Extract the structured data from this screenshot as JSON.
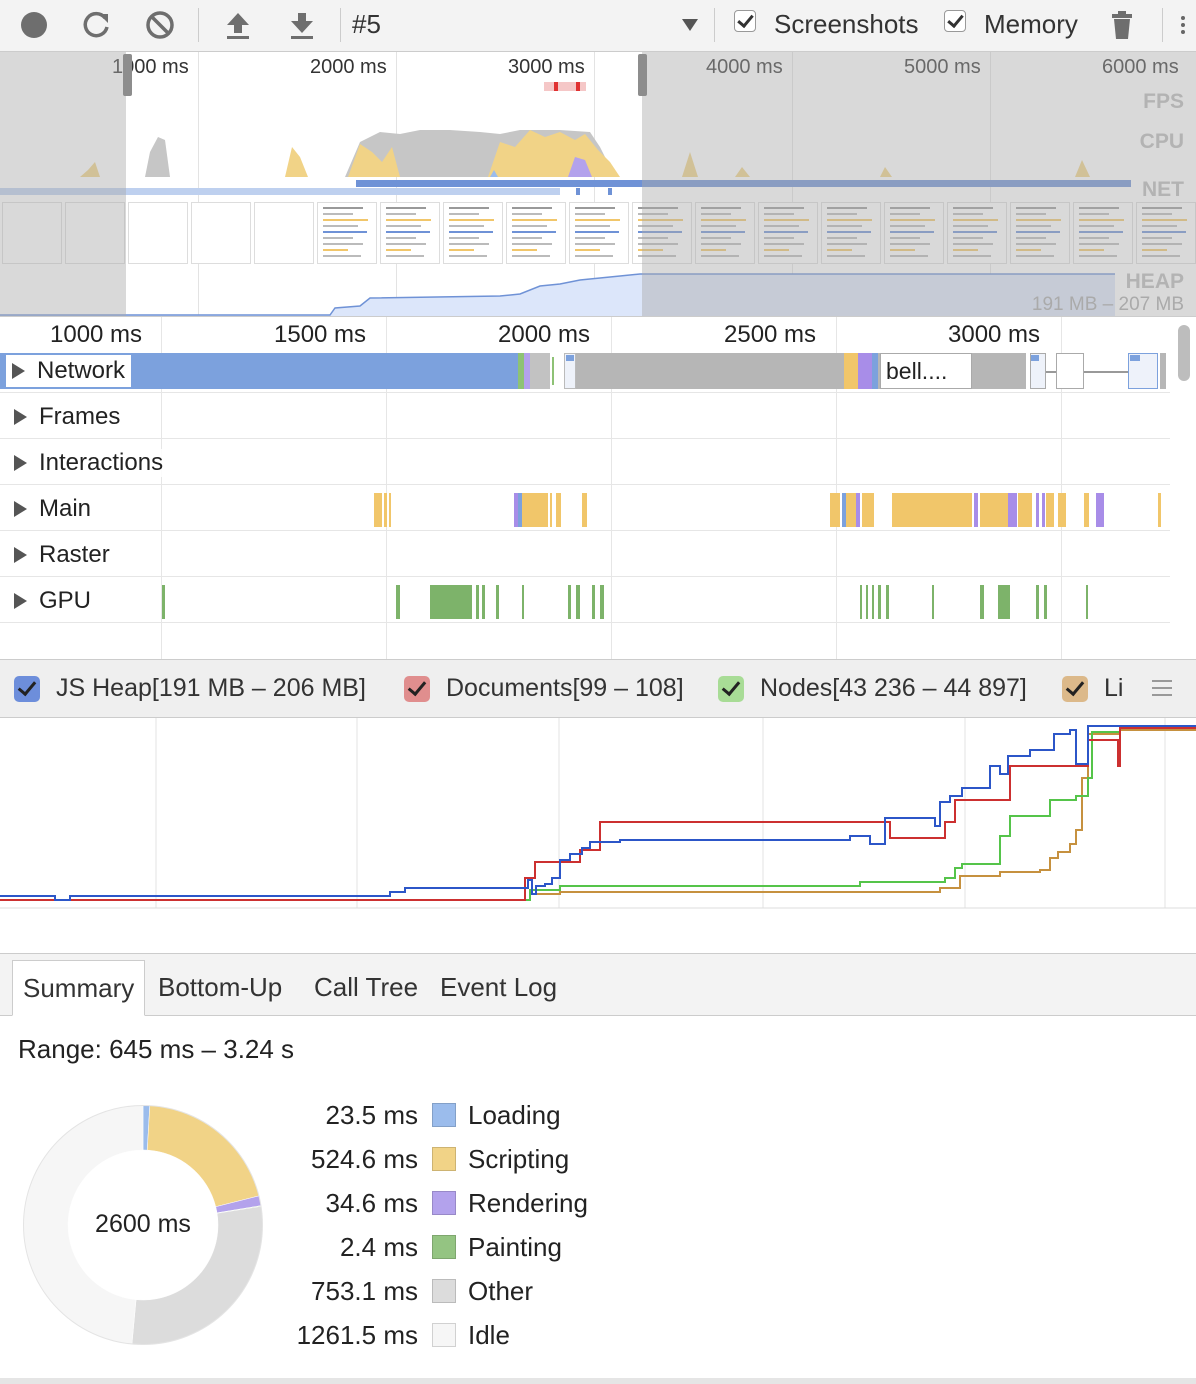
{
  "toolbar": {
    "icons": [
      "record-icon",
      "reload-icon",
      "clear-icon",
      "upload-icon",
      "download-icon"
    ],
    "recording_label": "#5",
    "screenshots_label": "Screenshots",
    "memory_label": "Memory",
    "trash_icon": "trash-icon"
  },
  "overview": {
    "ticks": [
      "1000 ms",
      "2000 ms",
      "3000 ms",
      "4000 ms",
      "5000 ms",
      "6000 ms"
    ],
    "labels": {
      "fps": "FPS",
      "cpu": "CPU",
      "net": "NET",
      "heap": "HEAP"
    },
    "heap_range": "191 MB – 207 MB"
  },
  "flame": {
    "ticks": [
      "1000 ms",
      "1500 ms",
      "2000 ms",
      "2500 ms",
      "3000 ms"
    ],
    "tracks": [
      "Network",
      "Frames",
      "Interactions",
      "Main",
      "Raster",
      "GPU"
    ],
    "network_item": "bell...."
  },
  "counters": [
    {
      "label": "JS Heap[191 MB – 206 MB]",
      "color": "#3b5bd6"
    },
    {
      "label": "Documents[99 – 108]",
      "color": "#d76b6b"
    },
    {
      "label": "Nodes[43 236 – 44 897]",
      "color": "#8fd17c"
    },
    {
      "label": "Li",
      "color": "#d2a870"
    }
  ],
  "tabs": [
    "Summary",
    "Bottom-Up",
    "Call Tree",
    "Event Log"
  ],
  "summary": {
    "range": "Range: 645 ms – 3.24 s",
    "total": "2600 ms",
    "legend": [
      {
        "value": "23.5 ms",
        "label": "Loading",
        "color": "#9bbcec",
        "ms": 23.5
      },
      {
        "value": "524.6 ms",
        "label": "Scripting",
        "color": "#f1d387",
        "ms": 524.6
      },
      {
        "value": "34.6 ms",
        "label": "Rendering",
        "color": "#b3a2ec",
        "ms": 34.6
      },
      {
        "value": "2.4 ms",
        "label": "Painting",
        "color": "#94c482",
        "ms": 2.4
      },
      {
        "value": "753.1 ms",
        "label": "Other",
        "color": "#dcdcdc",
        "ms": 753.1
      },
      {
        "value": "1261.5 ms",
        "label": "Idle",
        "color": "#f6f6f6",
        "ms": 1261.5
      }
    ]
  }
}
